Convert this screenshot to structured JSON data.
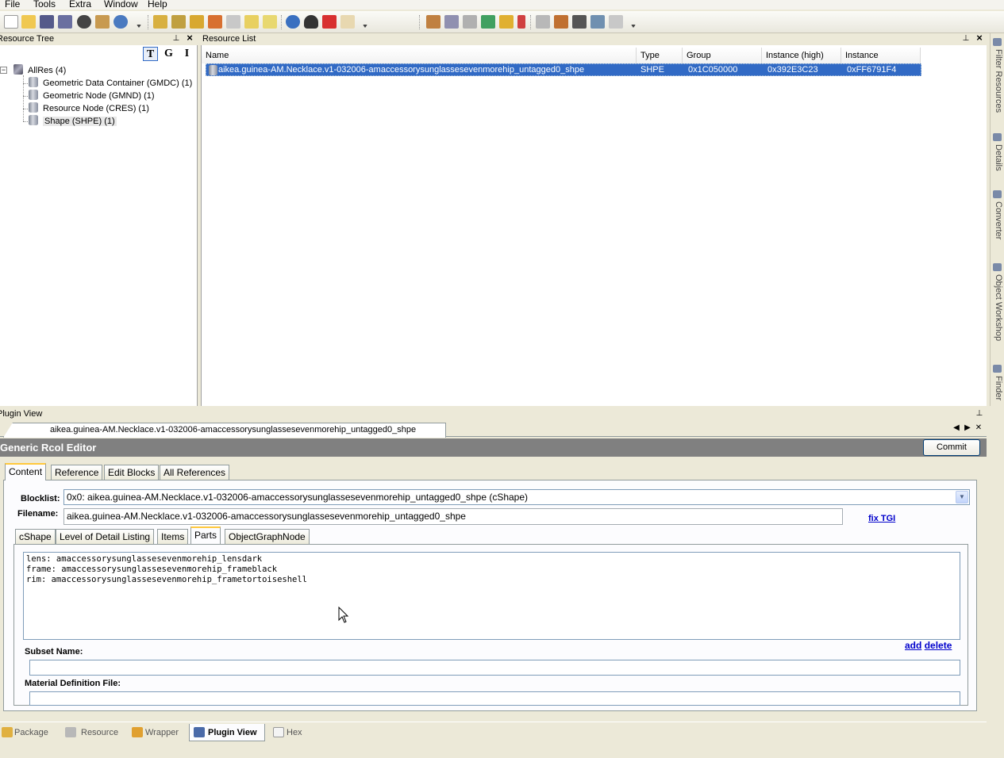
{
  "menu": {
    "items": [
      "File",
      "Tools",
      "Extra",
      "Window",
      "Help"
    ]
  },
  "resource_tree": {
    "title": "Resource Tree",
    "modes": [
      "T",
      "G",
      "I"
    ],
    "root": "AllRes (4)",
    "children": [
      "Geometric Data Container (GMDC) (1)",
      "Geometric Node (GMND) (1)",
      "Resource Node (CRES) (1)",
      "Shape (SHPE) (1)"
    ]
  },
  "resource_list": {
    "title": "Resource List",
    "columns": [
      "Name",
      "Type",
      "Group",
      "Instance (high)",
      "Instance"
    ],
    "row": {
      "name": "aikea.guinea-AM.Necklace.v1-032006-amaccessorysunglassesevenmorehip_untagged0_shpe",
      "type": "SHPE",
      "group": "0x1C050000",
      "instance_high": "0x392E3C23",
      "instance": "0xFF6791F4"
    }
  },
  "right_dock": {
    "tabs": [
      "Filter Resources",
      "Details",
      "Converter",
      "Object Workshop",
      "Finder"
    ]
  },
  "plugin_view": {
    "title": "Plugin View",
    "doc_tab": "aikea.guinea-AM.Necklace.v1-032006-amaccessorysunglassesevenmorehip_untagged0_shpe",
    "nav_left": "◀",
    "nav_right": "▶",
    "close": "✕"
  },
  "editor": {
    "title": "Generic Rcol Editor",
    "commit_label": "Commit",
    "tabs": [
      "Content",
      "Reference",
      "Edit Blocks",
      "All References"
    ],
    "blocklist_label": "Blocklist:",
    "blocklist_value": "0x0: aikea.guinea-AM.Necklace.v1-032006-amaccessorysunglassesevenmorehip_untagged0_shpe (cShape)",
    "filename_label": "Filename:",
    "filename_value": "aikea.guinea-AM.Necklace.v1-032006-amaccessorysunglassesevenmorehip_untagged0_shpe",
    "fix_tgi": "fix TGI",
    "sub_tabs": [
      "cShape",
      "Level of Detail Listing",
      "Items",
      "Parts",
      "ObjectGraphNode"
    ],
    "parts": [
      "lens: amaccessorysunglassesevenmorehip_lensdark",
      "frame: amaccessorysunglassesevenmorehip_frameblack",
      "rim: amaccessorysunglassesevenmorehip_frametortoiseshell"
    ],
    "add_label": "add",
    "delete_label": "delete",
    "subset_name_label": "Subset Name:",
    "material_label": "Material Definition File:"
  },
  "bottom_tabs": [
    "Package",
    "Resource",
    "Wrapper",
    "Plugin View",
    "Hex"
  ]
}
